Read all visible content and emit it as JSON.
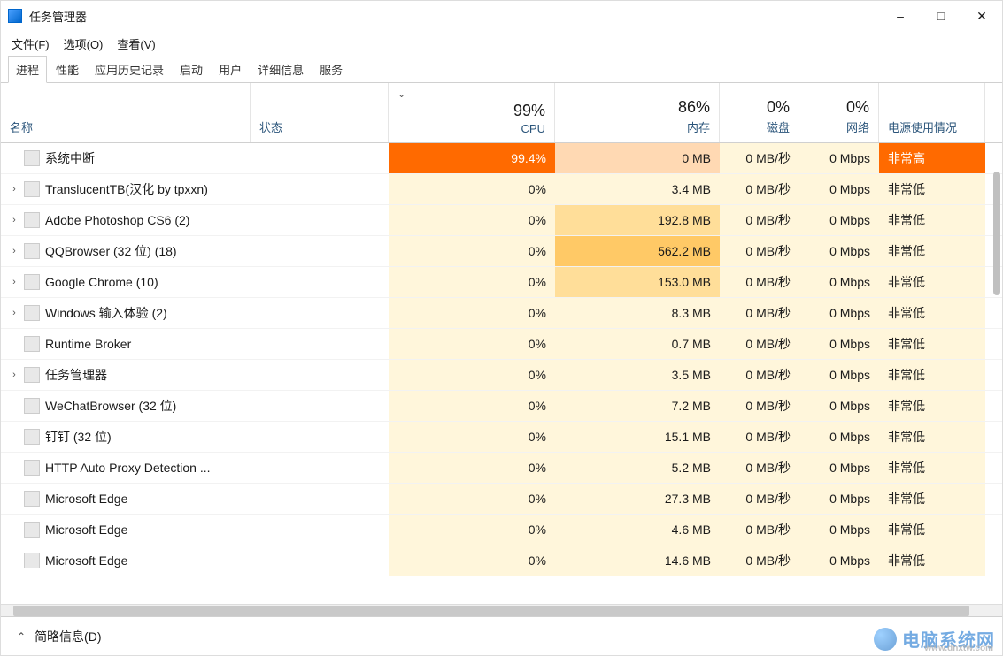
{
  "window": {
    "title": "任务管理器"
  },
  "menubar": {
    "file": "文件(F)",
    "options": "选项(O)",
    "view": "查看(V)"
  },
  "tabs": {
    "processes": "进程",
    "performance": "性能",
    "apphistory": "应用历史记录",
    "startup": "启动",
    "users": "用户",
    "details": "详细信息",
    "services": "服务"
  },
  "columns": {
    "name": "名称",
    "status": "状态",
    "cpu_pct": "99%",
    "cpu_label": "CPU",
    "mem_pct": "86%",
    "mem_label": "内存",
    "disk_pct": "0%",
    "disk_label": "磁盘",
    "net_pct": "0%",
    "net_label": "网络",
    "power_label": "电源使用情况"
  },
  "rows": [
    {
      "expand": "",
      "name": "系统中断",
      "cpu": "99.4%",
      "cpuHeat": "heat-orange",
      "mem": "0 MB",
      "memHeat": "heat-orange-lt",
      "disk": "0 MB/秒",
      "net": "0 Mbps",
      "power": "非常高",
      "powerHeat": "heat-orange"
    },
    {
      "expand": "›",
      "name": "TranslucentTB(汉化 by tpxxn)",
      "cpu": "0%",
      "cpuHeat": "",
      "mem": "3.4 MB",
      "memHeat": "",
      "disk": "0 MB/秒",
      "net": "0 Mbps",
      "power": "非常低",
      "powerHeat": ""
    },
    {
      "expand": "›",
      "name": "Adobe Photoshop CS6 (2)",
      "cpu": "0%",
      "cpuHeat": "",
      "mem": "192.8 MB",
      "memHeat": "heat-amber2",
      "disk": "0 MB/秒",
      "net": "0 Mbps",
      "power": "非常低",
      "powerHeat": ""
    },
    {
      "expand": "›",
      "name": "QQBrowser (32 位) (18)",
      "cpu": "0%",
      "cpuHeat": "",
      "mem": "562.2 MB",
      "memHeat": "heat-amber",
      "disk": "0 MB/秒",
      "net": "0 Mbps",
      "power": "非常低",
      "powerHeat": ""
    },
    {
      "expand": "›",
      "name": "Google Chrome (10)",
      "cpu": "0%",
      "cpuHeat": "",
      "mem": "153.0 MB",
      "memHeat": "heat-amber2",
      "disk": "0 MB/秒",
      "net": "0 Mbps",
      "power": "非常低",
      "powerHeat": ""
    },
    {
      "expand": "›",
      "name": "Windows 输入体验 (2)",
      "cpu": "0%",
      "cpuHeat": "",
      "mem": "8.3 MB",
      "memHeat": "",
      "disk": "0 MB/秒",
      "net": "0 Mbps",
      "power": "非常低",
      "powerHeat": ""
    },
    {
      "expand": "",
      "name": "Runtime Broker",
      "cpu": "0%",
      "cpuHeat": "",
      "mem": "0.7 MB",
      "memHeat": "",
      "disk": "0 MB/秒",
      "net": "0 Mbps",
      "power": "非常低",
      "powerHeat": ""
    },
    {
      "expand": "›",
      "name": "任务管理器",
      "cpu": "0%",
      "cpuHeat": "",
      "mem": "3.5 MB",
      "memHeat": "",
      "disk": "0 MB/秒",
      "net": "0 Mbps",
      "power": "非常低",
      "powerHeat": ""
    },
    {
      "expand": "",
      "name": "WeChatBrowser (32 位)",
      "cpu": "0%",
      "cpuHeat": "",
      "mem": "7.2 MB",
      "memHeat": "",
      "disk": "0 MB/秒",
      "net": "0 Mbps",
      "power": "非常低",
      "powerHeat": ""
    },
    {
      "expand": "",
      "name": "钉钉 (32 位)",
      "cpu": "0%",
      "cpuHeat": "",
      "mem": "15.1 MB",
      "memHeat": "",
      "disk": "0 MB/秒",
      "net": "0 Mbps",
      "power": "非常低",
      "powerHeat": ""
    },
    {
      "expand": "",
      "name": "HTTP Auto Proxy Detection ...",
      "cpu": "0%",
      "cpuHeat": "",
      "mem": "5.2 MB",
      "memHeat": "",
      "disk": "0 MB/秒",
      "net": "0 Mbps",
      "power": "非常低",
      "powerHeat": ""
    },
    {
      "expand": "",
      "name": "Microsoft Edge",
      "cpu": "0%",
      "cpuHeat": "",
      "mem": "27.3 MB",
      "memHeat": "",
      "disk": "0 MB/秒",
      "net": "0 Mbps",
      "power": "非常低",
      "powerHeat": ""
    },
    {
      "expand": "",
      "name": "Microsoft Edge",
      "cpu": "0%",
      "cpuHeat": "",
      "mem": "4.6 MB",
      "memHeat": "",
      "disk": "0 MB/秒",
      "net": "0 Mbps",
      "power": "非常低",
      "powerHeat": ""
    },
    {
      "expand": "",
      "name": "Microsoft Edge",
      "cpu": "0%",
      "cpuHeat": "",
      "mem": "14.6 MB",
      "memHeat": "",
      "disk": "0 MB/秒",
      "net": "0 Mbps",
      "power": "非常低",
      "powerHeat": ""
    }
  ],
  "footer": {
    "fewer_details": "简略信息(D)"
  },
  "watermark": {
    "text": "电脑系统网",
    "sub": "www.dnxtw.com"
  }
}
